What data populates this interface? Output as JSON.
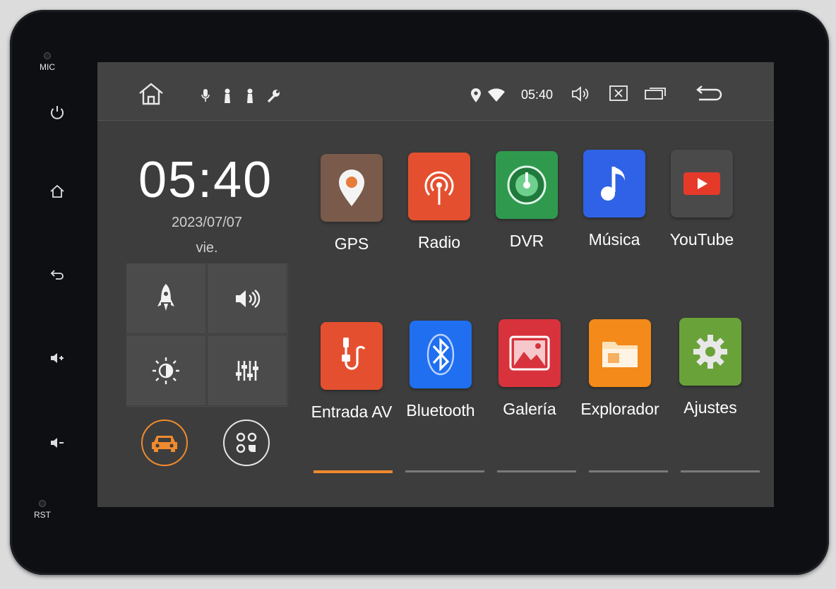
{
  "hardware": {
    "mic_label": "MIC",
    "rst_label": "RST",
    "buttons": [
      "power-icon",
      "home-icon",
      "back-icon",
      "volume-up-icon",
      "volume-down-icon"
    ]
  },
  "statusbar": {
    "left_icons": [
      "home-icon",
      "mic-icon",
      "usb-icon",
      "usb-icon",
      "wrench-icon"
    ],
    "right_icons": [
      "location-icon",
      "wifi-icon",
      "volume-icon",
      "close-app-icon",
      "recent-apps-icon",
      "back-icon"
    ],
    "time": "05:40"
  },
  "widget": {
    "clock": "05:40",
    "date": "2023/07/07",
    "day": "vie.",
    "quick_toggles": [
      "rocket-icon",
      "speaker-icon",
      "brightness-icon",
      "equalizer-icon"
    ]
  },
  "bottom_buttons": [
    "car-icon",
    "app-drawer-icon"
  ],
  "colors": {
    "accent": "#f08a2e",
    "gps": "#7a5a4a",
    "radio": "#e4502f",
    "dvr": "#2f9a4e",
    "musica": "#2f62e6",
    "youtube": "#4a4a4a",
    "entrada_av": "#e4502f",
    "bluetooth": "#1f6ff0",
    "galeria": "#d8323c",
    "explorador": "#f38a1a",
    "ajustes": "#6aa23a"
  },
  "apps": [
    {
      "label": "GPS"
    },
    {
      "label": "Radio"
    },
    {
      "label": "DVR"
    },
    {
      "label": "Música"
    },
    {
      "label": "YouTube"
    },
    {
      "label": "Entrada AV"
    },
    {
      "label": "Bluetooth"
    },
    {
      "label": "Galería"
    },
    {
      "label": "Explorador"
    },
    {
      "label": "Ajustes"
    }
  ],
  "pages": {
    "count": 5,
    "active": 1
  }
}
